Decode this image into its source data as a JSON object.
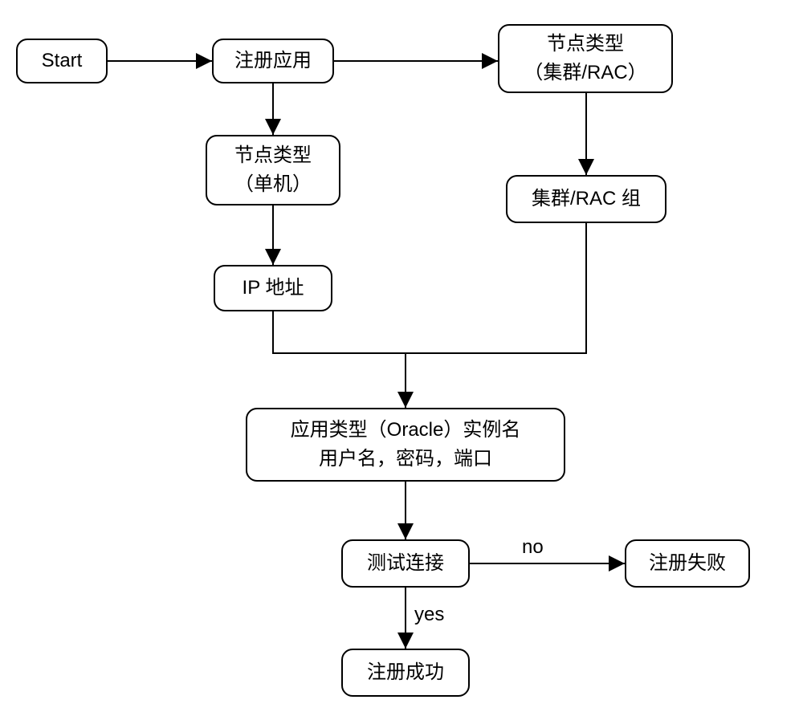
{
  "nodes": {
    "start": {
      "label": "Start"
    },
    "register": {
      "label": "注册应用"
    },
    "nodetype_cluster": {
      "label": "节点类型\n（集群/RAC）"
    },
    "nodetype_single": {
      "label": "节点类型\n（单机）"
    },
    "cluster_group": {
      "label": "集群/RAC 组"
    },
    "ip_addr": {
      "label": "IP 地址"
    },
    "oracle_info": {
      "label": "应用类型（Oracle）实例名\n用户名，密码，端口"
    },
    "test_conn": {
      "label": "测试连接"
    },
    "reg_fail": {
      "label": "注册失败"
    },
    "reg_success": {
      "label": "注册成功"
    }
  },
  "edge_labels": {
    "no": "no",
    "yes": "yes"
  }
}
